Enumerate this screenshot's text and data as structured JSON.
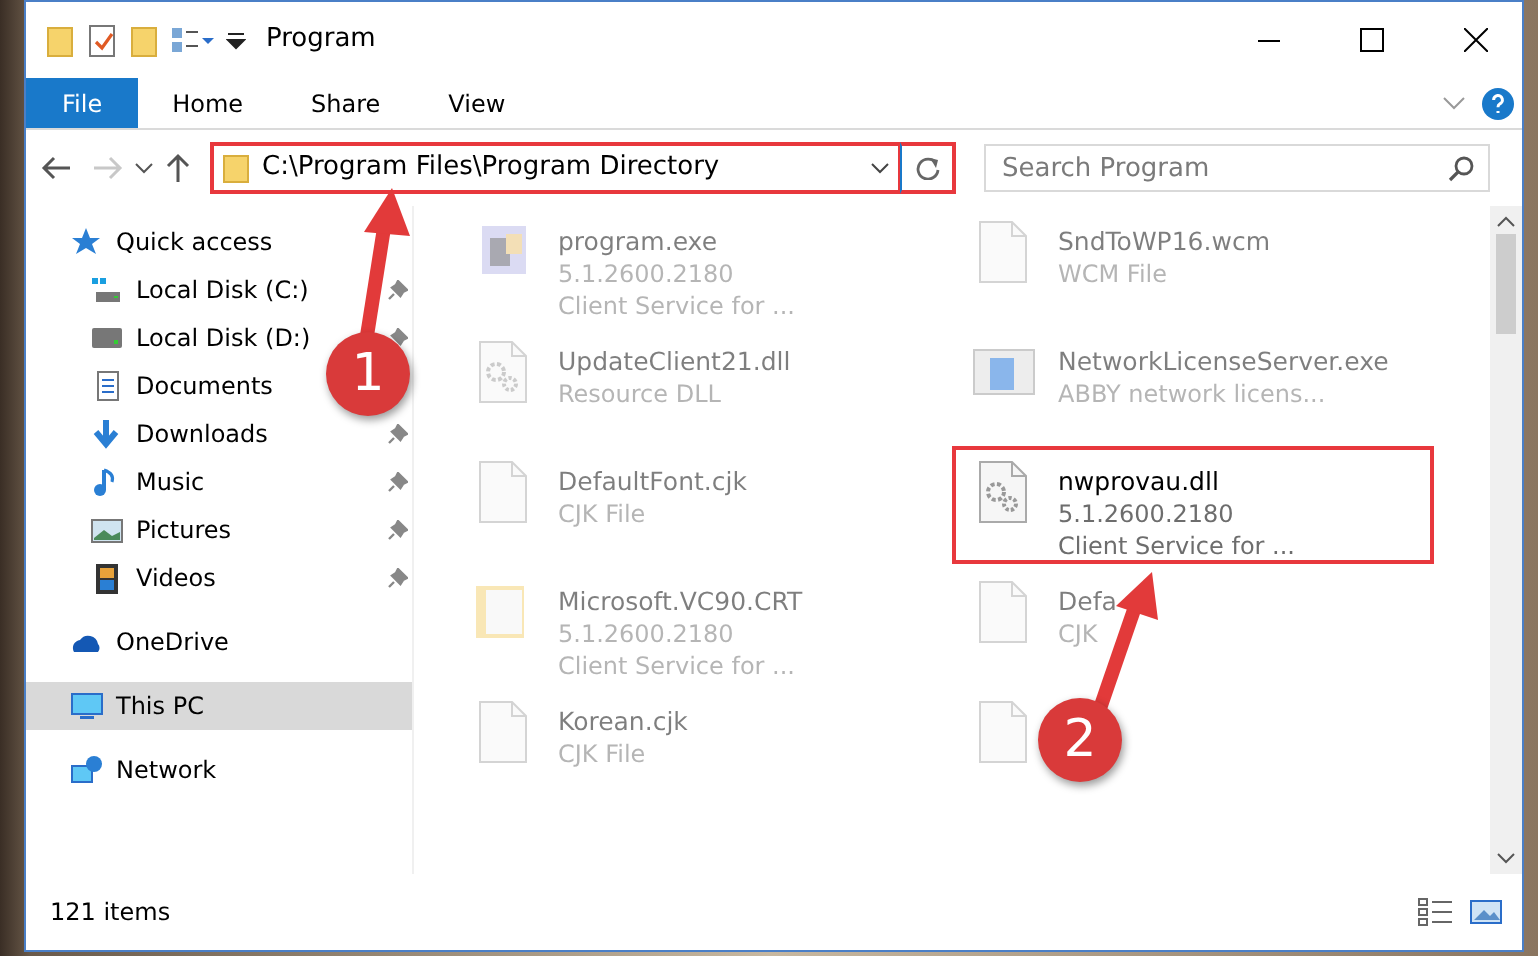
{
  "window": {
    "title": "Program"
  },
  "ribbon_tabs": [
    {
      "label": "File",
      "selected": true
    },
    {
      "label": "Home",
      "selected": false
    },
    {
      "label": "Share",
      "selected": false
    },
    {
      "label": "View",
      "selected": false
    }
  ],
  "address_bar": {
    "path": "C:\\Program Files\\Program Directory"
  },
  "search": {
    "placeholder": "Search Program"
  },
  "sidebar": {
    "items": [
      {
        "label": "Quick access",
        "kind": "quick",
        "selected": false,
        "children": [
          {
            "label": "Local Disk (C:)",
            "kind": "diskc",
            "pinned": true,
            "selected": false
          },
          {
            "label": "Local Disk (D:)",
            "kind": "disk",
            "pinned": true,
            "selected": false
          },
          {
            "label": "Documents",
            "kind": "docs",
            "pinned": false,
            "selected": false
          },
          {
            "label": "Downloads",
            "kind": "down",
            "pinned": true,
            "selected": false
          },
          {
            "label": "Music",
            "kind": "music",
            "pinned": true,
            "selected": false
          },
          {
            "label": "Pictures",
            "kind": "pics",
            "pinned": true,
            "selected": false
          },
          {
            "label": "Videos",
            "kind": "video",
            "pinned": true,
            "selected": false
          }
        ]
      },
      {
        "label": "OneDrive",
        "kind": "cloud",
        "selected": false
      },
      {
        "label": "This PC",
        "kind": "pc",
        "selected": true
      },
      {
        "label": "Network",
        "kind": "net",
        "selected": false
      }
    ]
  },
  "files": [
    {
      "name": "program.exe",
      "details": [
        "5.1.2600.2180",
        "Client Service for ..."
      ],
      "kind": "exe",
      "blurred": true
    },
    {
      "name": "SndToWP16.wcm",
      "details": [
        "WCM File"
      ],
      "kind": "file",
      "blurred": true
    },
    {
      "name": "UpdateClient21.dll",
      "details": [
        "Resource DLL"
      ],
      "kind": "dll",
      "blurred": true
    },
    {
      "name": "NetworkLicenseServer.exe",
      "details": [
        "ABBY network licens..."
      ],
      "kind": "app",
      "blurred": true
    },
    {
      "name": "DefaultFont.cjk",
      "details": [
        "CJK File"
      ],
      "kind": "file",
      "blurred": true
    },
    {
      "name": "nwprovau.dll",
      "details": [
        "5.1.2600.2180",
        "Client Service for ..."
      ],
      "kind": "dll",
      "blurred": false
    },
    {
      "name": "Microsoft.VC90.CRT",
      "details": [
        "5.1.2600.2180",
        "Client Service for ..."
      ],
      "kind": "folder",
      "blurred": true
    },
    {
      "name": "Defa",
      "details": [
        "CJK"
      ],
      "kind": "file",
      "blurred": true
    },
    {
      "name": "Korean.cjk",
      "details": [
        "CJK File"
      ],
      "kind": "file",
      "blurred": true
    },
    {
      "kind": "file",
      "blurred": true
    }
  ],
  "status_bar": {
    "count": "121 items"
  },
  "annotations": [
    {
      "number": "1"
    },
    {
      "number": "2"
    }
  ]
}
